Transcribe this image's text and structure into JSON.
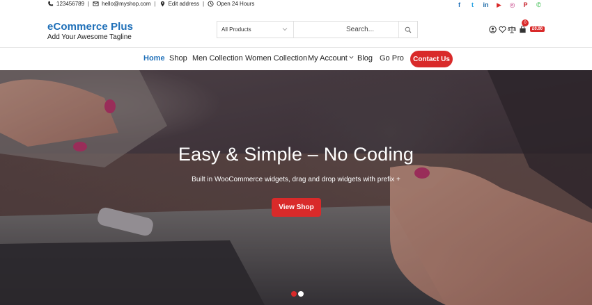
{
  "topbar": {
    "phone": "123456789",
    "email": "hello@myshop.com",
    "address": "Edit address",
    "hours": "Open 24 Hours",
    "social": [
      {
        "icon": "facebook-icon",
        "glyph": "f",
        "color": "#1e6fb8"
      },
      {
        "icon": "twitter-icon",
        "glyph": "t",
        "color": "#1e9ee0"
      },
      {
        "icon": "linkedin-icon",
        "glyph": "in",
        "color": "#1666a5"
      },
      {
        "icon": "youtube-icon",
        "glyph": "▶",
        "color": "#d92a2a"
      },
      {
        "icon": "instagram-icon",
        "glyph": "◎",
        "color": "#c2357f"
      },
      {
        "icon": "pinterest-icon",
        "glyph": "P",
        "color": "#c8232c"
      },
      {
        "icon": "whatsapp-icon",
        "glyph": "✆",
        "color": "#2bb741"
      }
    ]
  },
  "brand": {
    "title": "eCommerce Plus",
    "tagline": "Add Your Awesome Tagline"
  },
  "search": {
    "category": "All Products",
    "placeholder": "Search..."
  },
  "cart": {
    "count": "0",
    "total": "£0.00"
  },
  "nav": {
    "items": [
      {
        "label": "Home",
        "active": true
      },
      {
        "label": "Shop"
      },
      {
        "label": "Men Collection"
      },
      {
        "label": "Women Collection"
      },
      {
        "label": "My Account",
        "dropdown": true
      },
      {
        "label": "Blog"
      },
      {
        "label": "Go Pro"
      }
    ],
    "contact": "Contact Us"
  },
  "hero": {
    "title": "Easy & Simple – No Coding",
    "subtitle": "Built in WooCommerce widgets, drag and drop widgets with prefix +",
    "button": "View Shop",
    "slides": 2,
    "active_slide": 0
  },
  "colors": {
    "accent": "#d92a2a",
    "brand": "#1e6fb8"
  }
}
